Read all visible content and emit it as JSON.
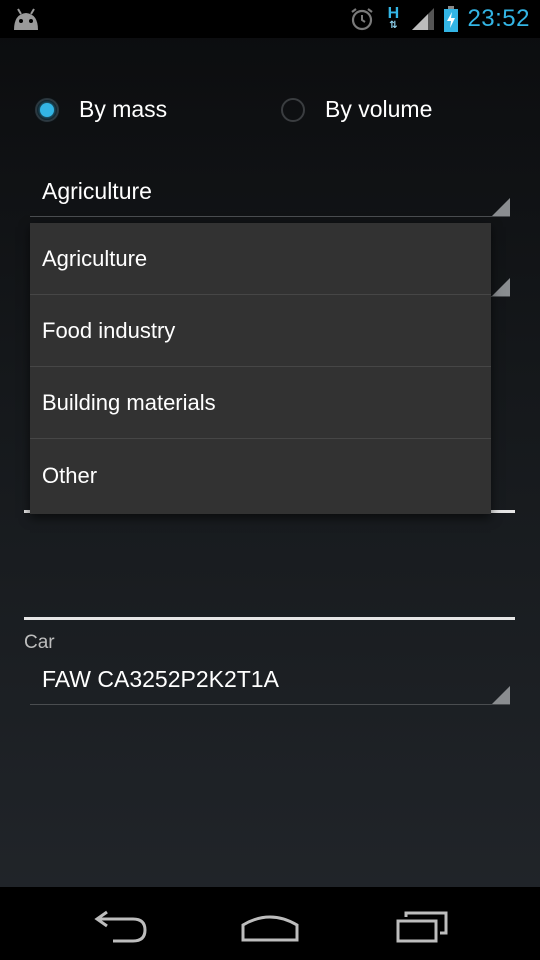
{
  "status_bar": {
    "time": "23:52",
    "network_type": "H",
    "icons": [
      "android-icon",
      "alarm-icon",
      "data-arrows-icon",
      "signal-icon",
      "battery-charging-icon"
    ],
    "accent_color": "#33b5e5"
  },
  "options": {
    "by_mass_label": "By mass",
    "by_volume_label": "By volume",
    "selected": "By mass"
  },
  "category_spinner": {
    "selected": "Agriculture"
  },
  "category_dropdown": {
    "items": [
      "Agriculture",
      "Food industry",
      "Building materials",
      "Other"
    ]
  },
  "car": {
    "label": "Car",
    "value": "FAW CA3252P2K2T1A"
  },
  "nav_bar": {
    "icons": [
      "back-icon",
      "home-icon",
      "recent-apps-icon"
    ]
  }
}
